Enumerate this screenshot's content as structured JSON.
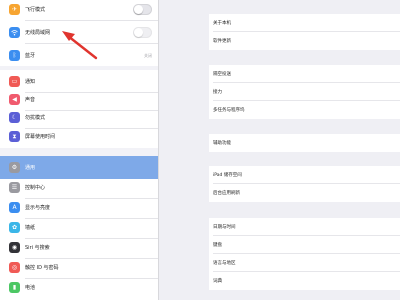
{
  "sidebar": {
    "items": [
      {
        "label": "飞行模式",
        "icon": "airplane-icon",
        "color": "#f7a531"
      },
      {
        "label": "无线局域网",
        "icon": "wifi-icon",
        "color": "#3b8ef0"
      },
      {
        "label": "蓝牙",
        "icon": "bluetooth-icon",
        "color": "#3b8ef0",
        "value": "关闭"
      },
      {
        "label": "通知",
        "icon": "notifications-icon",
        "color": "#f05a55"
      },
      {
        "label": "声音",
        "icon": "sound-icon",
        "color": "#f05a6e"
      },
      {
        "label": "勿扰模式",
        "icon": "moon-icon",
        "color": "#5b5fd6"
      },
      {
        "label": "屏幕使用时间",
        "icon": "hourglass-icon",
        "color": "#5b5fd6"
      },
      {
        "label": "通用",
        "icon": "gear-icon",
        "color": "#9a9aa0"
      },
      {
        "label": "控制中心",
        "icon": "control-center-icon",
        "color": "#9a9aa0"
      },
      {
        "label": "显示与亮度",
        "icon": "display-brightness-icon",
        "color": "#3b8ef0"
      },
      {
        "label": "墙纸",
        "icon": "wallpaper-icon",
        "color": "#3bb6e8"
      },
      {
        "label": "Siri 与搜索",
        "icon": "siri-icon",
        "color": "#333338"
      },
      {
        "label": "触控 ID 与密码",
        "icon": "touch-id-icon",
        "color": "#f05a55"
      },
      {
        "label": "电池",
        "icon": "battery-icon",
        "color": "#4cc764"
      }
    ]
  },
  "detail": {
    "rows": [
      "关于本机",
      "软件更新",
      "隔空投送",
      "接力",
      "多任务与程序坞",
      "辅助功能",
      "iPad 储存空间",
      "后台应用刷新",
      "日期与时间",
      "键盘",
      "语言与地区",
      "词典"
    ]
  },
  "colors": {
    "selected": "#7ea9e8",
    "annotation_arrow": "#e0342e"
  }
}
